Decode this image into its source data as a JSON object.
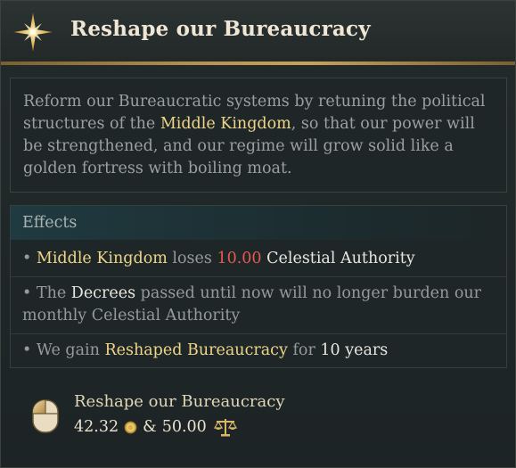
{
  "header": {
    "title": "Reshape our Bureaucracy"
  },
  "description": {
    "part1": "Reform our Bureaucratic systems by retuning the political structures of the ",
    "highlight": "Middle Kingdom",
    "part2": ", so that our power will be strengthened, and our regime will grow solid like a golden fortress with boiling moat."
  },
  "effects": {
    "heading": "Effects",
    "items": [
      {
        "bullet": "•",
        "subject": "Middle Kingdom",
        "verb": "loses",
        "value": "10.00",
        "object": "Celestial Authority"
      },
      {
        "bullet": "•",
        "pre": "The",
        "subject": "Decrees",
        "rest": "passed until now will no longer burden our monthly Celestial Authority"
      },
      {
        "bullet": "•",
        "pre": "We gain",
        "subject": "Reshaped Bureaucracy",
        "mid": "for",
        "duration": "10 years"
      }
    ]
  },
  "action": {
    "title": "Reshape our Bureaucracy",
    "cost_gold": "42.32",
    "joiner": "&",
    "cost_legitimacy": "50.00"
  },
  "icons": {
    "header": "compass-star-icon",
    "action": "mouse-left-click-icon",
    "gold": "gold-coin-icon",
    "legitimacy": "scales-icon"
  },
  "colors": {
    "highlight": "#eed58a",
    "negative": "#e25a50",
    "gold_rule": "#b8944f"
  }
}
